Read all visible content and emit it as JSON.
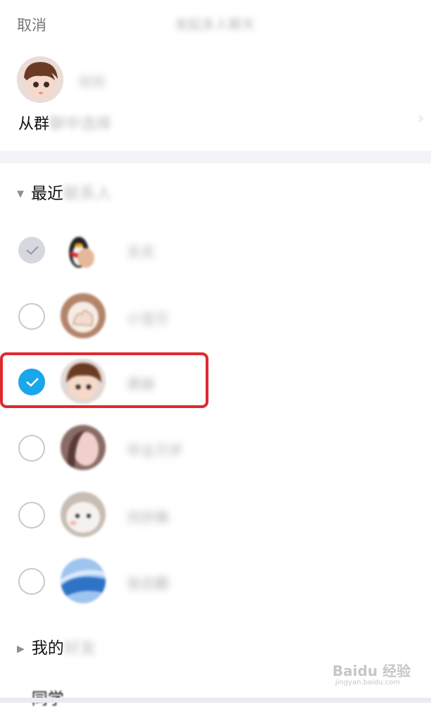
{
  "header": {
    "cancel_label": "取消",
    "title": "发起多人聊天"
  },
  "self": {
    "name": "昵称"
  },
  "group_entry": {
    "visible_label": "从群",
    "rest_label": "聊中选择"
  },
  "sections": {
    "recent": {
      "visible_label": "最近",
      "rest_label": "联系人"
    },
    "friends": {
      "visible_label": "我的",
      "rest_label": "好友"
    },
    "classmates": {
      "visible_label": "同学"
    }
  },
  "contacts": [
    {
      "name": "天天",
      "state": "disabled",
      "avatar_icon": "penguin-avatar-icon"
    },
    {
      "name": "小宝贝",
      "state": "unchecked",
      "avatar_icon": "hand-avatar-icon"
    },
    {
      "name": "表妹",
      "state": "checked",
      "avatar_icon": "cartoon-boy-avatar-icon"
    },
    {
      "name": "毕业万岁",
      "state": "unchecked",
      "avatar_icon": "girl-avatar-icon"
    },
    {
      "name": "刘亦姝",
      "state": "unchecked",
      "avatar_icon": "hamster-avatar-icon"
    },
    {
      "name": "张志鹏",
      "state": "unchecked",
      "avatar_icon": "blue-abstract-avatar-icon"
    }
  ],
  "watermark": {
    "brand": "Baidu 经验",
    "url": "jingyan.baidu.com"
  },
  "colors": {
    "accent_check": "#1aa6ea",
    "highlight_border": "#e0282f",
    "disabled_check": "#d6d8de"
  }
}
